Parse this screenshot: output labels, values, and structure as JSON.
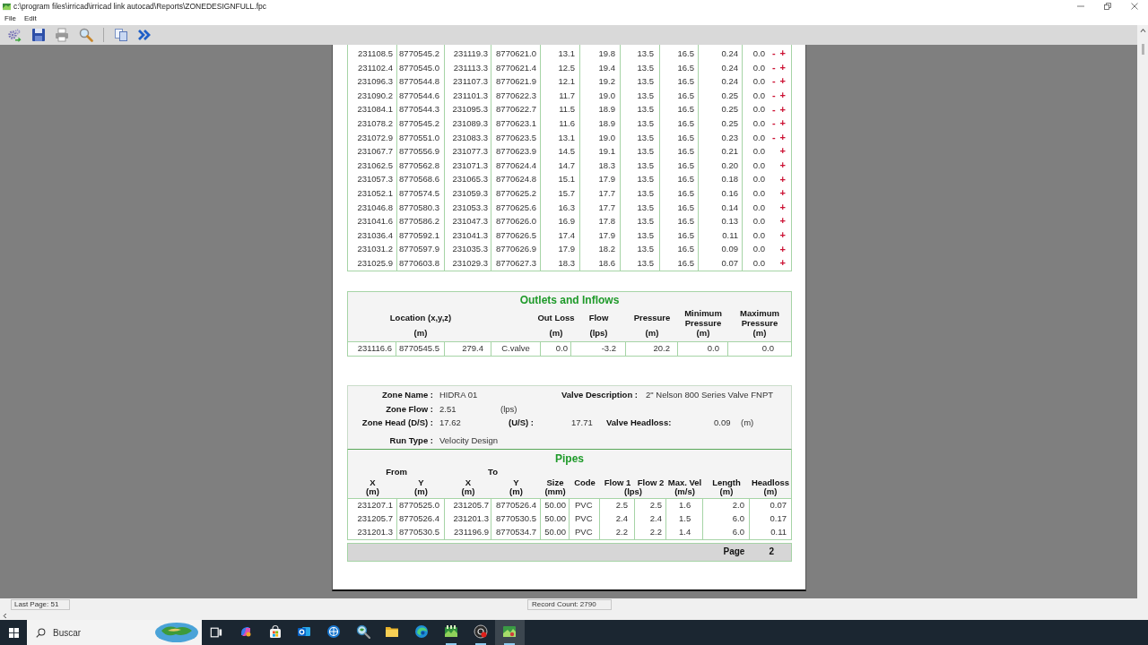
{
  "window": {
    "title": "c:\\program files\\irricad\\irricad link autocad\\Reports\\ZONEDESIGNFULL.fpc"
  },
  "menu": [
    "File",
    "Edit"
  ],
  "report": {
    "upper_table": {
      "rows": [
        {
          "cells": [
            "231108.5",
            "8770545.2",
            "231119.3",
            "8770621.0",
            "13.1",
            "19.8",
            "13.5",
            "16.5",
            "0.24",
            "0.0"
          ],
          "marks": [
            "-",
            "+"
          ]
        },
        {
          "cells": [
            "231102.4",
            "8770545.0",
            "231113.3",
            "8770621.4",
            "12.5",
            "19.4",
            "13.5",
            "16.5",
            "0.24",
            "0.0"
          ],
          "marks": [
            "-",
            "+"
          ]
        },
        {
          "cells": [
            "231096.3",
            "8770544.8",
            "231107.3",
            "8770621.9",
            "12.1",
            "19.2",
            "13.5",
            "16.5",
            "0.24",
            "0.0"
          ],
          "marks": [
            "-",
            "+"
          ]
        },
        {
          "cells": [
            "231090.2",
            "8770544.6",
            "231101.3",
            "8770622.3",
            "11.7",
            "19.0",
            "13.5",
            "16.5",
            "0.25",
            "0.0"
          ],
          "marks": [
            "-",
            "+"
          ]
        },
        {
          "cells": [
            "231084.1",
            "8770544.3",
            "231095.3",
            "8770622.7",
            "11.5",
            "18.9",
            "13.5",
            "16.5",
            "0.25",
            "0.0"
          ],
          "marks": [
            "-",
            "+"
          ]
        },
        {
          "cells": [
            "231078.2",
            "8770545.2",
            "231089.3",
            "8770623.1",
            "11.6",
            "18.9",
            "13.5",
            "16.5",
            "0.25",
            "0.0"
          ],
          "marks": [
            "-",
            "+"
          ]
        },
        {
          "cells": [
            "231072.9",
            "8770551.0",
            "231083.3",
            "8770623.5",
            "13.1",
            "19.0",
            "13.5",
            "16.5",
            "0.23",
            "0.0"
          ],
          "marks": [
            "-",
            "+"
          ]
        },
        {
          "cells": [
            "231067.7",
            "8770556.9",
            "231077.3",
            "8770623.9",
            "14.5",
            "19.1",
            "13.5",
            "16.5",
            "0.21",
            "0.0"
          ],
          "marks": [
            "+"
          ]
        },
        {
          "cells": [
            "231062.5",
            "8770562.8",
            "231071.3",
            "8770624.4",
            "14.7",
            "18.3",
            "13.5",
            "16.5",
            "0.20",
            "0.0"
          ],
          "marks": [
            "+"
          ]
        },
        {
          "cells": [
            "231057.3",
            "8770568.6",
            "231065.3",
            "8770624.8",
            "15.1",
            "17.9",
            "13.5",
            "16.5",
            "0.18",
            "0.0"
          ],
          "marks": [
            "+"
          ]
        },
        {
          "cells": [
            "231052.1",
            "8770574.5",
            "231059.3",
            "8770625.2",
            "15.7",
            "17.7",
            "13.5",
            "16.5",
            "0.16",
            "0.0"
          ],
          "marks": [
            "+"
          ]
        },
        {
          "cells": [
            "231046.8",
            "8770580.3",
            "231053.3",
            "8770625.6",
            "16.3",
            "17.7",
            "13.5",
            "16.5",
            "0.14",
            "0.0"
          ],
          "marks": [
            "+"
          ]
        },
        {
          "cells": [
            "231041.6",
            "8770586.2",
            "231047.3",
            "8770626.0",
            "16.9",
            "17.8",
            "13.5",
            "16.5",
            "0.13",
            "0.0"
          ],
          "marks": [
            "+"
          ]
        },
        {
          "cells": [
            "231036.4",
            "8770592.1",
            "231041.3",
            "8770626.5",
            "17.4",
            "17.9",
            "13.5",
            "16.5",
            "0.11",
            "0.0"
          ],
          "marks": [
            "+"
          ]
        },
        {
          "cells": [
            "231031.2",
            "8770597.9",
            "231035.3",
            "8770626.9",
            "17.9",
            "18.2",
            "13.5",
            "16.5",
            "0.09",
            "0.0"
          ],
          "marks": [
            "+"
          ]
        },
        {
          "cells": [
            "231025.9",
            "8770603.8",
            "231029.3",
            "8770627.3",
            "18.3",
            "18.6",
            "13.5",
            "16.5",
            "0.07",
            "0.0"
          ],
          "marks": [
            "+"
          ]
        }
      ]
    },
    "outlets": {
      "title": "Outlets and Inflows",
      "columns": [
        {},
        {
          "label": "Location (x,y,z)",
          "unit": "(m)"
        },
        {},
        {},
        {
          "label": "Out Loss",
          "unit": "(m)"
        },
        {
          "label": "Flow",
          "unit": "(lps)"
        },
        {
          "label": "Pressure",
          "unit": "(m)"
        },
        {
          "label": "Minimum Pressure",
          "unit": "(m)"
        },
        {
          "label": "Maximum Pressure",
          "unit": "(m)"
        }
      ],
      "rows": [
        [
          "231116.6",
          "8770545.5",
          "279.4",
          "C.valve",
          "0.0",
          "-3.2",
          "20.2",
          "0.0",
          "0.0"
        ]
      ]
    },
    "zone": {
      "zone_name": {
        "label": "Zone Name :",
        "value": "HIDRA 01"
      },
      "valve_description": {
        "label": "Valve Description :",
        "value": "2\" Nelson 800 Series Valve FNPT"
      },
      "zone_flow": {
        "label": "Zone Flow :",
        "value": "2.51",
        "unit": "(lps)"
      },
      "zone_head": {
        "label": "Zone Head (D/S) :",
        "value": "17.62"
      },
      "upstream_head": {
        "label": "(U/S) :",
        "value": "17.71"
      },
      "valve_headloss": {
        "label": "Valve Headloss:",
        "value": "0.09",
        "unit": "(m)"
      },
      "run_type": {
        "label": "Run Type :",
        "value": "Velocity Design"
      }
    },
    "pipes": {
      "title": "Pipes",
      "groups": [
        {
          "label": "From"
        },
        {
          "label": "To"
        }
      ],
      "columns": [
        {
          "label": "X",
          "unit": "(m)"
        },
        {
          "label": "Y",
          "unit": "(m)"
        },
        {
          "label": "X",
          "unit": "(m)"
        },
        {
          "label": "Y",
          "unit": "(m)"
        },
        {
          "label": "Size",
          "unit": "(mm)"
        },
        {
          "label": "Code"
        },
        {
          "label": "Flow 1"
        },
        {
          "label": "Flow 2"
        },
        {
          "label": "Max. Vel",
          "unit": "(m/s)"
        },
        {
          "label": "Length",
          "unit": "(m)"
        },
        {
          "label": "Headloss",
          "unit": "(m)"
        }
      ],
      "flow_unit": "(lps)",
      "rows": [
        [
          "231207.1",
          "8770525.0",
          "231205.7",
          "8770526.4",
          "50.00",
          "PVC",
          "2.5",
          "2.5",
          "1.6",
          "2.0",
          "0.07"
        ],
        [
          "231205.7",
          "8770526.4",
          "231201.3",
          "8770530.5",
          "50.00",
          "PVC",
          "2.4",
          "2.4",
          "1.5",
          "6.0",
          "0.17"
        ],
        [
          "231201.3",
          "8770530.5",
          "231196.9",
          "8770534.7",
          "50.00",
          "PVC",
          "2.2",
          "2.2",
          "1.4",
          "6.0",
          "0.11"
        ]
      ]
    },
    "footer": {
      "label": "Page",
      "number": "2"
    }
  },
  "status_bar": {
    "last_page": "Last Page: 51",
    "record_count": "Record Count: 2790"
  },
  "taskbar": {
    "search": {
      "placeholder": "Buscar"
    },
    "apps": [
      {
        "running": false,
        "active": false
      },
      {
        "running": false,
        "active": false
      },
      {
        "running": false,
        "active": false
      },
      {
        "running": false,
        "active": false
      },
      {
        "running": false,
        "active": false
      },
      {
        "running": false,
        "active": false
      },
      {
        "running": false,
        "active": false
      },
      {
        "running": true,
        "active": false
      },
      {
        "running": true,
        "active": false
      },
      {
        "running": true,
        "active": true
      }
    ]
  }
}
